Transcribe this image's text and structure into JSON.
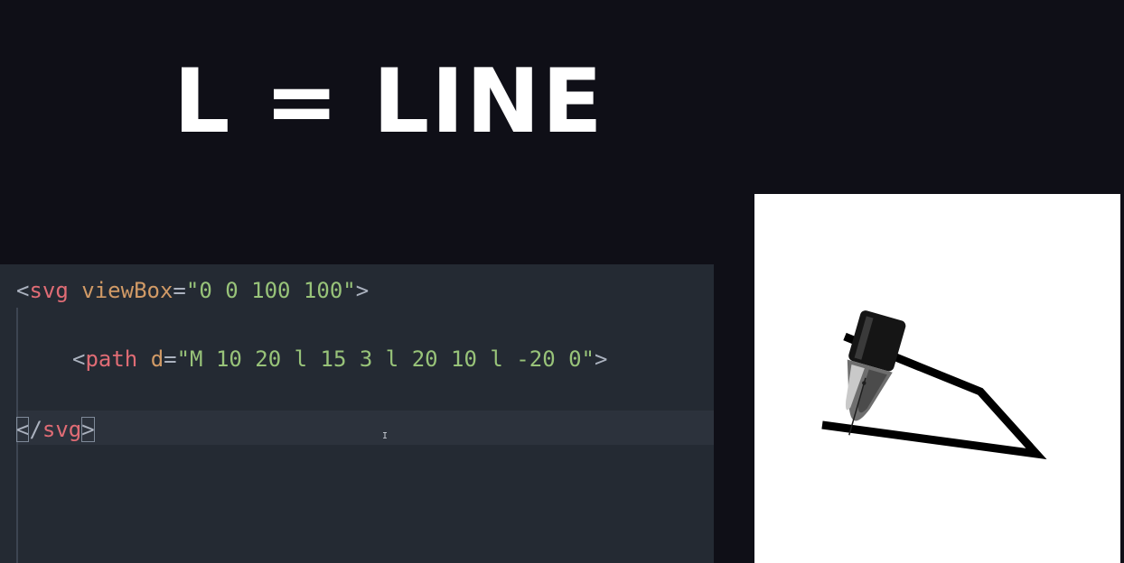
{
  "title": "L = LINE",
  "code": {
    "line1": {
      "open": "<",
      "tag": "svg",
      "space": " ",
      "attr": "viewBox",
      "eq": "=",
      "value": "\"0 0 100 100\"",
      "close": ">"
    },
    "line2": {
      "open": "<",
      "tag": "path",
      "space": " ",
      "attr": "d",
      "eq": "=",
      "value": "\"M 10 20 l 15 3 l 20 10 l -20 0\"",
      "close": ">"
    },
    "line3": {
      "open": "<",
      "slash": "/",
      "tag": "svg",
      "close": ">"
    }
  },
  "cursor_glyph": "I",
  "preview": {
    "background": "#ffffff",
    "stroke_color": "#000000",
    "pen_icon": "fountain-pen-icon"
  },
  "colors": {
    "page_background": "#0f0f17",
    "editor_background": "#242a33",
    "tag": "#e06c75",
    "attribute": "#d19a66",
    "string": "#98c379"
  }
}
